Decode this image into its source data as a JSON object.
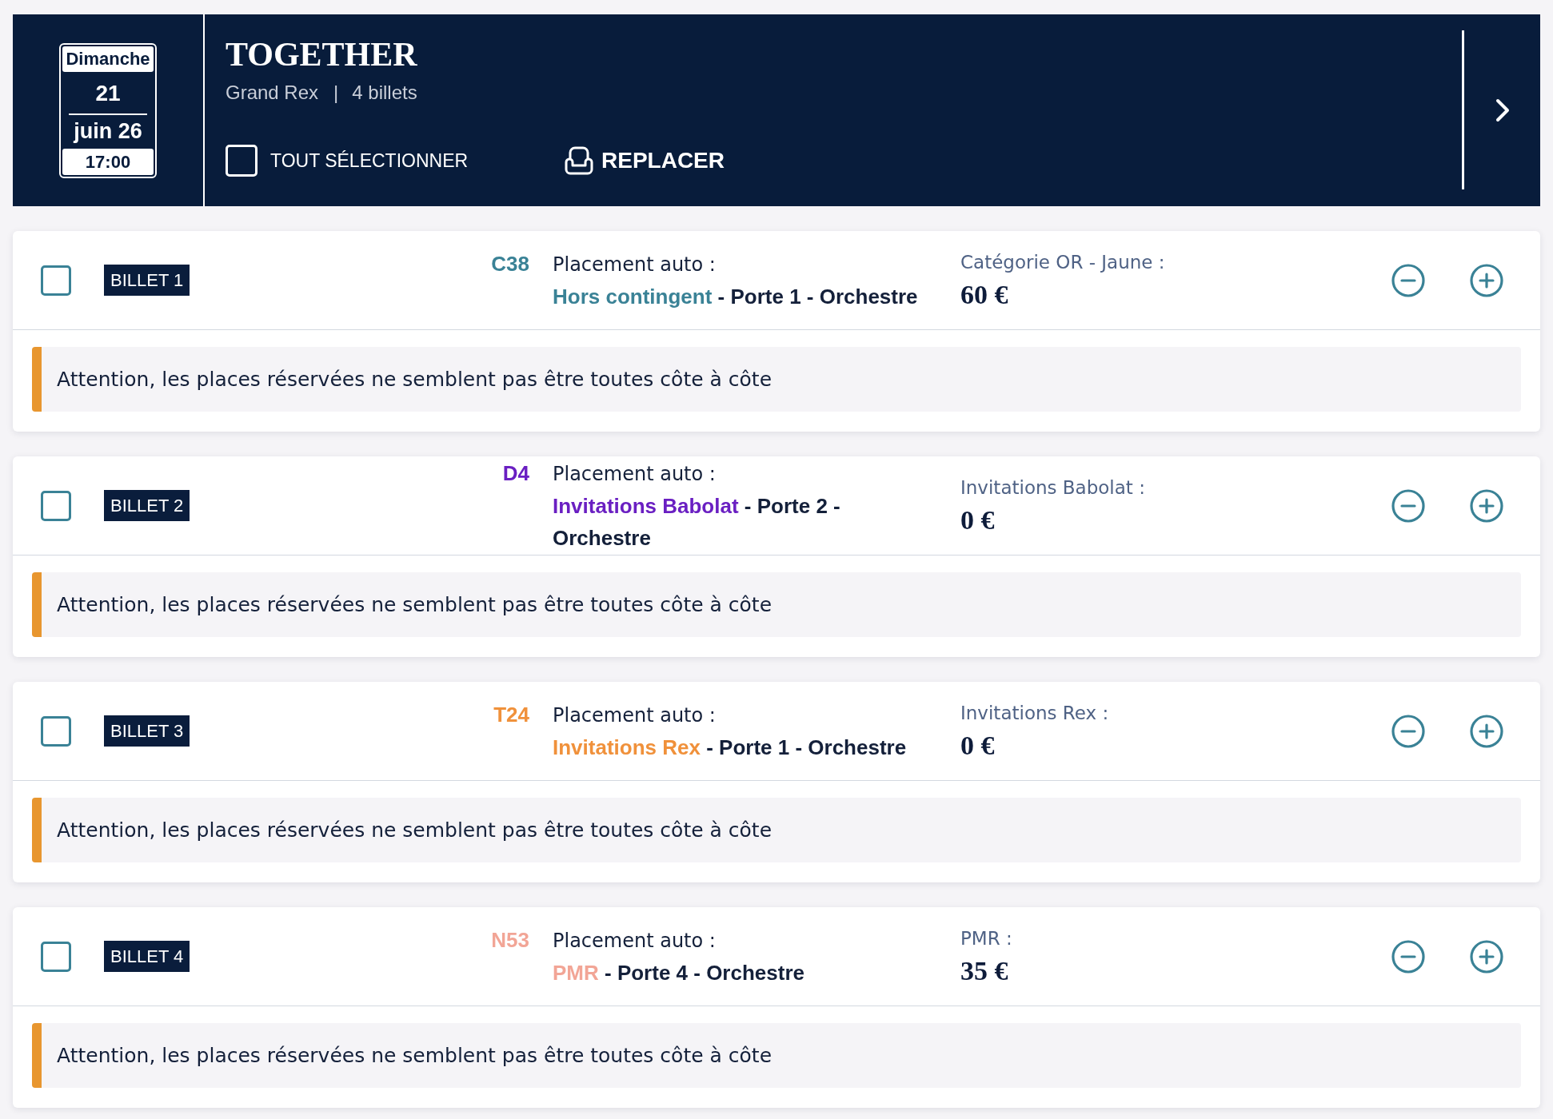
{
  "event": {
    "date": {
      "weekday": "Dimanche",
      "day": "21",
      "month_year": "juin 26",
      "time": "17:00"
    },
    "title": "TOGETHER",
    "venue": "Grand Rex",
    "separator": "|",
    "ticket_count": "4 billets"
  },
  "select_all": {
    "label": "TOUT SÉLECTIONNER",
    "checked": false
  },
  "replace_button": {
    "label": "REPLACER"
  },
  "tickets": [
    {
      "label": "BILLET 1",
      "checked": false,
      "seat": "C38",
      "color": "#3a8296",
      "placement_label": "Placement auto :",
      "contingent": "Hors contingent",
      "location": "- Porte 1 - Orchestre",
      "category": "Catégorie OR - Jaune :",
      "price": "60 €",
      "warning": "Attention, les places réservées ne semblent pas être toutes côte à côte"
    },
    {
      "label": "BILLET 2",
      "checked": false,
      "seat": "D4",
      "color": "#6a1fc2",
      "placement_label": "Placement auto :",
      "contingent": "Invitations Babolat",
      "location": "- Porte 2 - Orchestre",
      "category": "Invitations Babolat :",
      "price": "0 €",
      "warning": "Attention, les places réservées ne semblent pas être toutes côte à côte"
    },
    {
      "label": "BILLET 3",
      "checked": false,
      "seat": "T24",
      "color": "#f0913b",
      "placement_label": "Placement auto :",
      "contingent": "Invitations Rex",
      "location": "- Porte 1 - Orchestre",
      "category": "Invitations Rex :",
      "price": "0 €",
      "warning": "Attention, les places réservées ne semblent pas être toutes côte à côte"
    },
    {
      "label": "BILLET 4",
      "checked": false,
      "seat": "N53",
      "color": "#f2a596",
      "placement_label": "Placement auto :",
      "contingent": "PMR",
      "location": "- Porte 4 - Orchestre",
      "category": "PMR :",
      "price": "35 €",
      "warning": "Attention, les places réservées ne semblent pas être toutes côte à côte"
    }
  ]
}
